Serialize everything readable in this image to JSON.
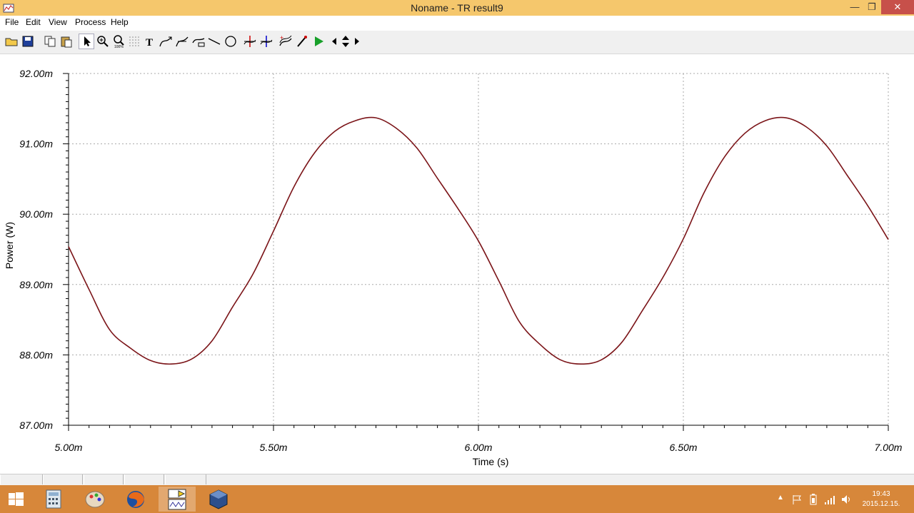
{
  "window": {
    "title": "Noname - TR result9",
    "minimize_glyph": "—",
    "restore_glyph": "❐",
    "close_glyph": "✕"
  },
  "menu": [
    {
      "label": "File"
    },
    {
      "label": "Edit"
    },
    {
      "label": "View"
    },
    {
      "label": "Process"
    },
    {
      "label": "Help"
    }
  ],
  "toolbar": [
    {
      "icon": "open-folder-icon"
    },
    {
      "icon": "save-icon"
    },
    {
      "icon": "copy-icon"
    },
    {
      "icon": "paste-icon"
    },
    {
      "icon": "pointer-icon"
    },
    {
      "icon": "zoom-in-icon"
    },
    {
      "icon": "zoom-100-icon"
    },
    {
      "icon": "grid-icon"
    },
    {
      "icon": "text-icon"
    },
    {
      "icon": "curve-arrow-icon"
    },
    {
      "icon": "curve-arrow-2-icon"
    },
    {
      "icon": "curve-label-icon"
    },
    {
      "icon": "line-icon"
    },
    {
      "icon": "circle-icon"
    },
    {
      "icon": "cursor-a-icon"
    },
    {
      "icon": "cursor-b-icon"
    },
    {
      "icon": "add-curve-icon"
    },
    {
      "icon": "probe-icon"
    },
    {
      "icon": "run-icon"
    },
    {
      "icon": "arrow-left-icon"
    },
    {
      "icon": "arrow-updown-icon"
    },
    {
      "icon": "arrow-right-icon"
    }
  ],
  "chart_data": {
    "type": "line",
    "xlabel": "Time (s)",
    "ylabel": "Power (W)",
    "xlim": [
      0.005,
      0.007
    ],
    "ylim": [
      0.087,
      0.092
    ],
    "x_ticks": [
      "5.00m",
      "5.50m",
      "6.00m",
      "6.50m",
      "7.00m"
    ],
    "y_ticks": [
      "92.00m",
      "91.00m",
      "90.00m",
      "89.00m",
      "88.00m",
      "87.00m"
    ],
    "grid": true,
    "line_color": "#7b1418",
    "series": [
      {
        "x": [
          0.005,
          0.00505,
          0.0051,
          0.00515,
          0.0052,
          0.00525,
          0.0053,
          0.00535,
          0.0054,
          0.00545,
          0.0055,
          0.00555,
          0.0056,
          0.00565,
          0.0057,
          0.00575,
          0.0058,
          0.00585,
          0.0059,
          0.00595,
          0.006,
          0.00605,
          0.0061,
          0.00615,
          0.0062,
          0.00625,
          0.0063,
          0.00635,
          0.0064,
          0.00645,
          0.0065,
          0.00655,
          0.0066,
          0.00665,
          0.0067,
          0.00675,
          0.0068,
          0.00685,
          0.0069,
          0.00695,
          0.007
        ],
        "y": [
          0.08954,
          0.08893,
          0.08836,
          0.0881,
          0.08792,
          0.08787,
          0.08794,
          0.0882,
          0.08868,
          0.08915,
          0.08976,
          0.09039,
          0.09087,
          0.09118,
          0.09133,
          0.09137,
          0.09122,
          0.09094,
          0.09051,
          0.09008,
          0.08962,
          0.08905,
          0.08847,
          0.08815,
          0.08793,
          0.08787,
          0.08793,
          0.08818,
          0.08863,
          0.0891,
          0.08965,
          0.0903,
          0.09081,
          0.09115,
          0.09133,
          0.09137,
          0.09124,
          0.09097,
          0.09055,
          0.09012,
          0.08964
        ]
      }
    ]
  },
  "taskbar": {
    "apps": [
      {
        "icon": "windows-start-icon"
      },
      {
        "icon": "calculator-icon"
      },
      {
        "icon": "paint-icon"
      },
      {
        "icon": "firefox-icon"
      },
      {
        "icon": "tina-circuit-icon"
      },
      {
        "icon": "virtualbox-icon"
      }
    ],
    "tray": {
      "time": "19:43",
      "date": "2015.12.15."
    }
  }
}
